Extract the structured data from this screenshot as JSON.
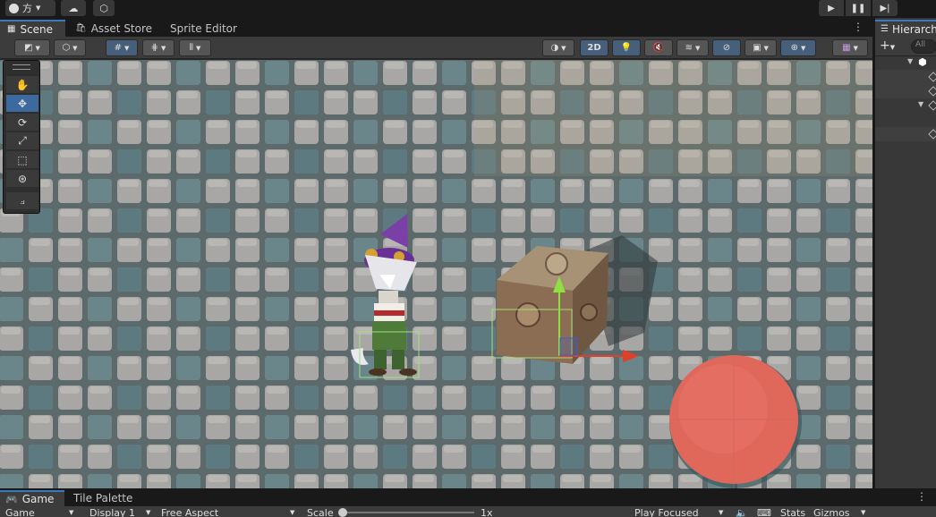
{
  "topbar": {
    "account_label": "方",
    "play_icons": [
      "play-icon",
      "pause-icon",
      "step-icon"
    ]
  },
  "scene_tabs": [
    {
      "label": "Scene",
      "active": true
    },
    {
      "label": "Asset Store",
      "active": false
    },
    {
      "label": "Sprite Editor",
      "active": false
    }
  ],
  "scene_toolbar": {
    "mode_2d_label": "2D"
  },
  "tools": [
    "hand",
    "move",
    "rotate",
    "scale",
    "rect",
    "transform",
    "custom"
  ],
  "hierarchy": {
    "tab_label": "Hierarchy",
    "search_placeholder": "All"
  },
  "bottom_tabs": [
    {
      "label": "Game",
      "active": true
    },
    {
      "label": "Tile Palette",
      "active": false
    }
  ],
  "game_bar": {
    "view_label": "Game",
    "display_label": "Display 1",
    "aspect_label": "Free Aspect",
    "scale_label": "Scale",
    "scale_value": "1x",
    "play_mode_label": "Play Focused",
    "stats_label": "Stats",
    "gizmos_label": "Gizmos"
  },
  "colors": {
    "accent": "#3a79bb",
    "move_y_arrow": "#8fe040",
    "move_x_arrow": "#e0402a",
    "selection": "#9fe07a"
  }
}
